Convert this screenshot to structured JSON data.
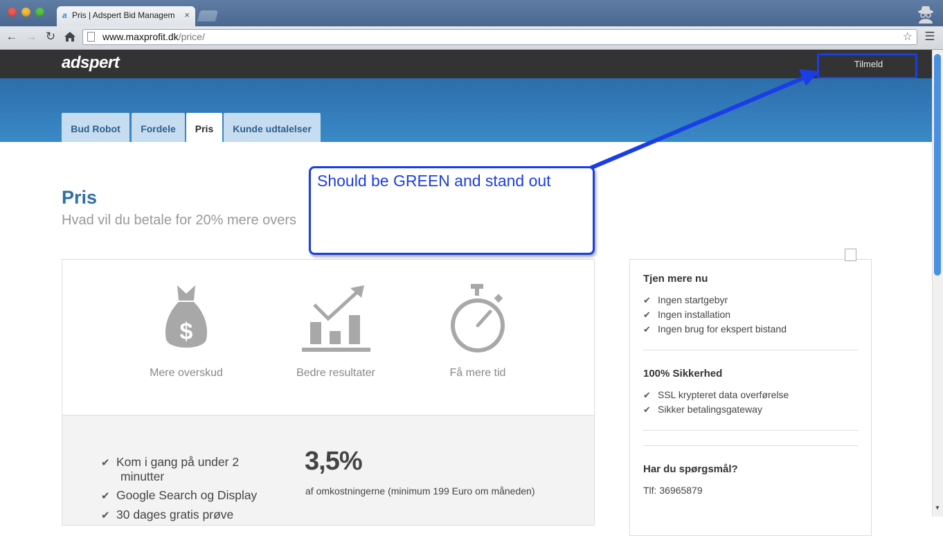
{
  "browser": {
    "tab_title": "Pris | Adspert Bid Management",
    "tab_favicon": "a",
    "tab_close": "×",
    "url_host": "www.maxprofit.dk",
    "url_path": "/price/",
    "icons": [
      "back-icon",
      "forward-icon",
      "reload-icon",
      "home-icon",
      "page-icon",
      "star-icon",
      "menu-icon",
      "incognito-icon"
    ]
  },
  "header": {
    "logo": "adspert",
    "signup_label": "Tilmeld"
  },
  "nav": {
    "tabs": [
      {
        "label": "Bud Robot",
        "active": false
      },
      {
        "label": "Fordele",
        "active": false
      },
      {
        "label": "Pris",
        "active": true
      },
      {
        "label": "Kunde udtalelser",
        "active": false
      }
    ]
  },
  "page": {
    "title": "Pris",
    "subtitle": "Hvad vil du betale for 20% mere overs"
  },
  "features": [
    {
      "icon": "money-bag-icon",
      "label": "Mere overskud"
    },
    {
      "icon": "growth-chart-icon",
      "label": "Bedre resultater"
    },
    {
      "icon": "stopwatch-icon",
      "label": "Få mere tid"
    }
  ],
  "pricing": {
    "benefits": [
      "Kom i gang på under 2",
      "minutter",
      "Google Search og Display",
      "30 dages gratis prøve"
    ],
    "price": "3,5%",
    "price_note": "af omkostningerne (minimum 199 Euro om måneden)"
  },
  "sidebar": {
    "section1_title": "Tjen mere nu",
    "section1_items": [
      "Ingen startgebyr",
      "Ingen installation",
      "Ingen brug for ekspert bistand"
    ],
    "section2_title": "100% Sikkerhed",
    "section2_items": [
      "SSL krypteret data overførelse",
      "Sikker betalingsgateway"
    ],
    "section3_title": "Har du spørgsmål?",
    "phone": "Tlf: 36965879"
  },
  "annotation": {
    "text": "Should be GREEN and stand out",
    "color": "#1a3ee6"
  },
  "colors": {
    "header_bg": "#333333",
    "hero_blue": "#3282c2",
    "title_blue": "#2d6fa6"
  }
}
